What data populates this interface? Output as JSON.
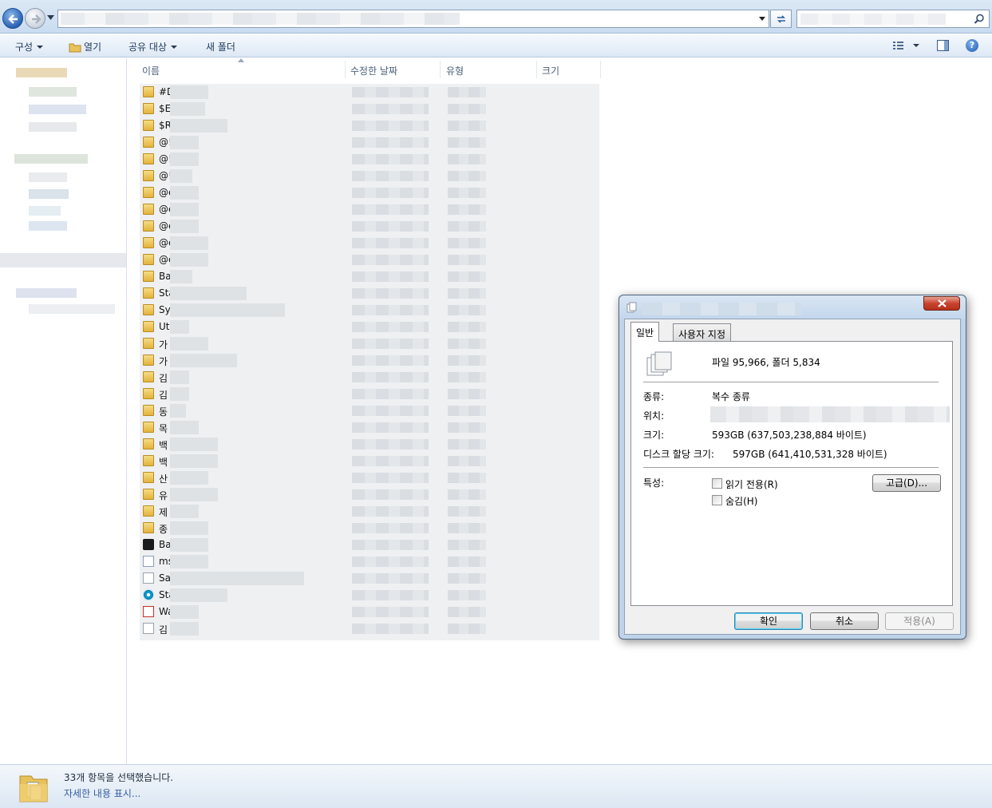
{
  "commandbar": {
    "organize": "구성",
    "open": "열기",
    "share": "공유 대상",
    "new_folder": "새 폴더"
  },
  "columns": {
    "name": "이름",
    "modified": "수정한 날짜",
    "type": "유형",
    "size": "크기"
  },
  "files": [
    {
      "prefix": "#D",
      "icon": "folder-icon"
    },
    {
      "prefix": "$E",
      "icon": "folder-icon"
    },
    {
      "prefix": "$R",
      "icon": "folder-icon"
    },
    {
      "prefix": "@!",
      "icon": "folder-icon"
    },
    {
      "prefix": "@!",
      "icon": "folder-icon"
    },
    {
      "prefix": "@!",
      "icon": "folder-icon"
    },
    {
      "prefix": "@e",
      "icon": "folder-icon"
    },
    {
      "prefix": "@e",
      "icon": "folder-icon"
    },
    {
      "prefix": "@e",
      "icon": "folder-icon"
    },
    {
      "prefix": "@e",
      "icon": "folder-icon"
    },
    {
      "prefix": "@e",
      "icon": "folder-icon"
    },
    {
      "prefix": "Ba",
      "icon": "folder-icon"
    },
    {
      "prefix": "Sta",
      "icon": "folder-icon"
    },
    {
      "prefix": "Sy",
      "icon": "folder-icon"
    },
    {
      "prefix": "Uti",
      "icon": "folder-icon"
    },
    {
      "prefix": "가",
      "icon": "folder-icon"
    },
    {
      "prefix": "가",
      "icon": "folder-icon"
    },
    {
      "prefix": "김",
      "icon": "folder-icon"
    },
    {
      "prefix": "김",
      "icon": "folder-icon"
    },
    {
      "prefix": "동",
      "icon": "folder-icon"
    },
    {
      "prefix": "목",
      "icon": "folder-icon"
    },
    {
      "prefix": "백",
      "icon": "folder-icon"
    },
    {
      "prefix": "백",
      "icon": "folder-icon"
    },
    {
      "prefix": "산",
      "icon": "folder-icon"
    },
    {
      "prefix": "유",
      "icon": "folder-icon"
    },
    {
      "prefix": "제",
      "icon": "folder-icon"
    },
    {
      "prefix": "종",
      "icon": "folder-icon"
    },
    {
      "prefix": "Ba",
      "icon": "exe-icon"
    },
    {
      "prefix": "ms",
      "icon": "link-icon"
    },
    {
      "prefix": "Sa",
      "icon": "doc-icon"
    },
    {
      "prefix": "Sta",
      "icon": "swirl-icon"
    },
    {
      "prefix": "Wa",
      "icon": "pdf-icon"
    },
    {
      "prefix": "김",
      "icon": "doc-icon"
    }
  ],
  "details": {
    "selected_count": "33개 항목을 선택했습니다.",
    "show_more": "자세한 내용 표시..."
  },
  "dialog": {
    "tabs": {
      "general": "일반",
      "custom": "사용자 지정"
    },
    "summary": "파일 95,966, 폴더 5,834",
    "type_label": "종류:",
    "type_value": "복수 종류",
    "location_label": "위치:",
    "size_label": "크기:",
    "size_value": "593GB (637,503,238,884 바이트)",
    "disk_label": "디스크 할당 크기:",
    "disk_value": "597GB (641,410,531,328 바이트)",
    "attributes_label": "특성:",
    "readonly": "읽기 전용(R)",
    "hidden": "숨김(H)",
    "advanced": "고급(D)...",
    "ok": "확인",
    "cancel": "취소",
    "apply": "적용(A)"
  },
  "help_glyph": "?"
}
